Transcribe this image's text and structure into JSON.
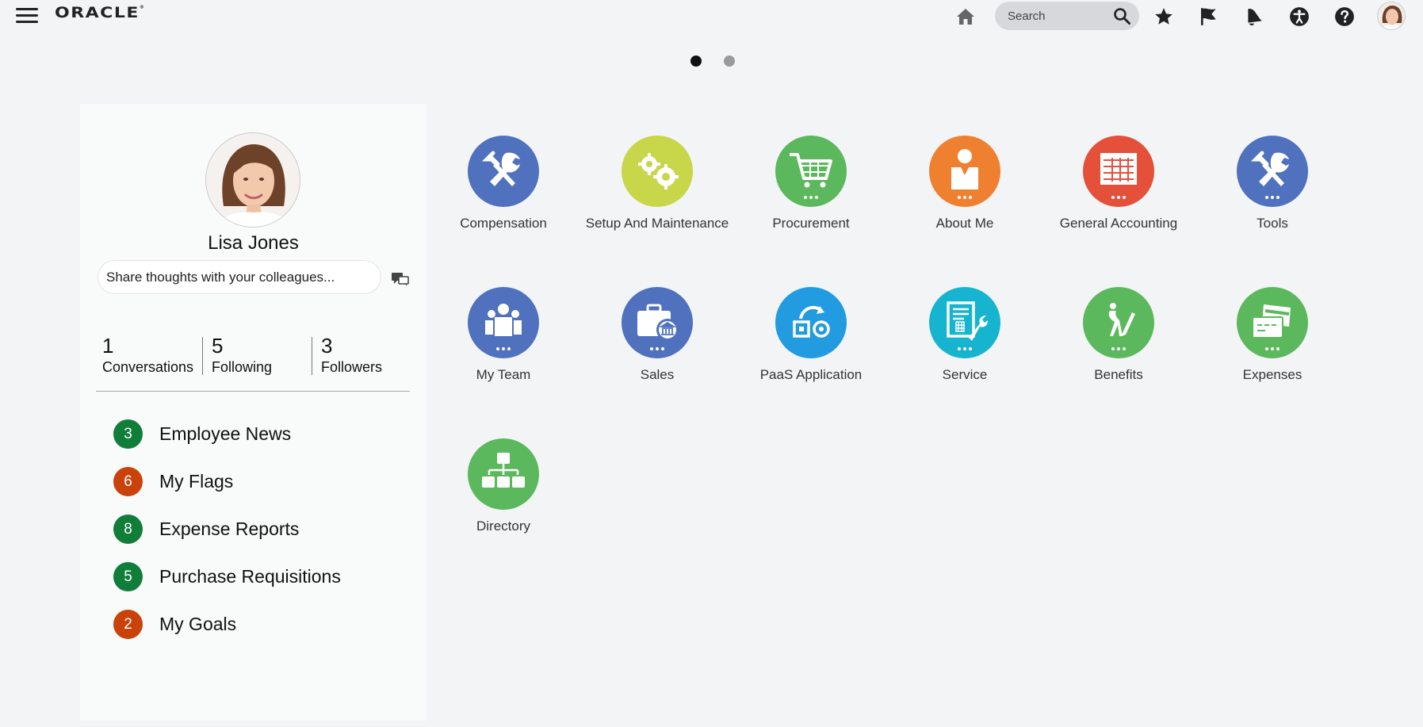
{
  "header": {
    "logo_text": "ORACLE",
    "search_placeholder": "Search",
    "icons": [
      "menu-icon",
      "home-icon",
      "search-icon",
      "favorites-star-icon",
      "flag-icon",
      "bell-icon",
      "accessibility-icon",
      "help-icon"
    ]
  },
  "pager": {
    "current": 1,
    "total": 2
  },
  "profile": {
    "name": "Lisa Jones",
    "share_placeholder": "Share thoughts with your colleagues...",
    "stats": [
      {
        "count": "1",
        "label": "Conversations"
      },
      {
        "count": "5",
        "label": "Following"
      },
      {
        "count": "3",
        "label": "Followers"
      }
    ]
  },
  "worklist": [
    {
      "count": "3",
      "label": "Employee News",
      "color": "#107d39"
    },
    {
      "count": "6",
      "label": "My Flags",
      "color": "#c8420a"
    },
    {
      "count": "8",
      "label": "Expense Reports",
      "color": "#107d39"
    },
    {
      "count": "5",
      "label": "Purchase Requisitions",
      "color": "#107d39"
    },
    {
      "count": "2",
      "label": "My Goals",
      "color": "#c8420a"
    }
  ],
  "apps": [
    {
      "label": "Compensation",
      "color": "#4f71be",
      "icon": "tools-icon"
    },
    {
      "label": "Setup And Maintenance",
      "color": "#c8d64a",
      "icon": "gears-icon"
    },
    {
      "label": "Procurement",
      "color": "#5cb85c",
      "icon": "cart-icon"
    },
    {
      "label": "About Me",
      "color": "#ef8030",
      "icon": "person-icon"
    },
    {
      "label": "General Accounting",
      "color": "#e4503a",
      "icon": "ledger-icon"
    },
    {
      "label": "Tools",
      "color": "#4f71be",
      "icon": "tools-icon"
    },
    {
      "label": "My Team",
      "color": "#4f71be",
      "icon": "team-icon"
    },
    {
      "label": "Sales",
      "color": "#4f71be",
      "icon": "briefcase-bank-icon"
    },
    {
      "label": "PaaS Application",
      "color": "#229be0",
      "icon": "paas-icon"
    },
    {
      "label": "Service",
      "color": "#16b4cf",
      "icon": "service-icon"
    },
    {
      "label": "Benefits",
      "color": "#5cb85c",
      "icon": "benefits-icon"
    },
    {
      "label": "Expenses",
      "color": "#5cb85c",
      "icon": "expenses-card-icon"
    },
    {
      "label": "Directory",
      "color": "#5cb85c",
      "icon": "org-chart-icon"
    }
  ]
}
